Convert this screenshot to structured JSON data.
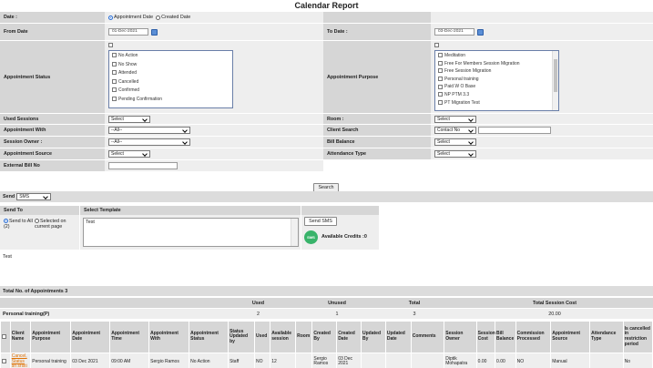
{
  "title": "Calendar Report",
  "filters": {
    "date_label": "Date :",
    "date_opt_appointment": "Appointment Date",
    "date_opt_created": "Created Date",
    "from_label": "From Date",
    "from_value": "01-Dec-2021",
    "to_label": "To Date :",
    "to_value": "03-Dec-2021",
    "status_label": "Appointment Status",
    "status_items": [
      "No Action",
      "No Show",
      "Attended",
      "Cancelled",
      "Confirmed",
      "Pending Confirmation"
    ],
    "purpose_label": "Appointment Purpose",
    "purpose_items": [
      "Meditation",
      "Free For Members Session Migration",
      "Free Session Migration",
      "Personal training",
      "Paid W O Base",
      "NP PTM 3.3",
      "PT Migration Test"
    ],
    "used_sessions_label": "Used Sessions",
    "used_sessions_value": "Select",
    "room_label": "Room :",
    "room_value": "Select",
    "appt_with_label": "Appointment With",
    "appt_with_value": "--All--",
    "client_search_label": "Client Search",
    "client_search_value": "Contact No",
    "session_owner_label": "Session Owner :",
    "session_owner_value": "--All--",
    "bill_balance_label": "Bill Balance",
    "bill_balance_value": "Select",
    "appt_source_label": "Appointment Source",
    "appt_source_value": "Select",
    "attendance_label": "Attendance Type",
    "attendance_value": "Select",
    "ext_bill_label": "External Bill No",
    "search_button": "Search"
  },
  "sms": {
    "send_label": "Send",
    "send_select": "SMS",
    "send_to_header": "Send To",
    "template_header": "Select Template",
    "opt_all": "Send to All (2)",
    "opt_selected": "Selected on current page",
    "template_value": "Test",
    "send_sms_button": "Send SMS",
    "credits_icon": "SMS",
    "credits_text": "Available Credits :0"
  },
  "test_label": "Test",
  "totals": {
    "heading": "Total No. of Appointments 3",
    "headers": [
      "Used",
      "Unused",
      "Total",
      "Total Session Cost"
    ],
    "row_label": "Personal training(P)",
    "values": [
      "2",
      "1",
      "3",
      "20.00"
    ]
  },
  "table": {
    "headers": [
      "",
      "Client Name",
      "Appointment Purpose",
      "Appointment Date",
      "Appointment Time",
      "Appointment With",
      "Appointment Status",
      "Status Updated by",
      "Used",
      "Available session",
      "Room",
      "Created By",
      "Created Date",
      "Updated By",
      "Updated Date",
      "Comments",
      "Session Owner",
      "Session Cost",
      "Bill Balance",
      "Commission Processed",
      "Appointment Source",
      "Attendance Type",
      "Is cancelled in restriction period"
    ],
    "rows": [
      [
        "",
        "Cancel, Status",
        "Personal training",
        "03 Dec 2021",
        "09:00 AM",
        "Sergio Ramos",
        "No Action",
        "Staff",
        "NO",
        "12",
        "",
        "Sergio Ramos",
        "03 Dec 2021",
        "",
        "",
        "",
        "Diptik Mohapatra",
        "0.00",
        "0.00",
        "NO",
        "Manual",
        "",
        "No"
      ]
    ],
    "row_link": "sri sristi"
  }
}
